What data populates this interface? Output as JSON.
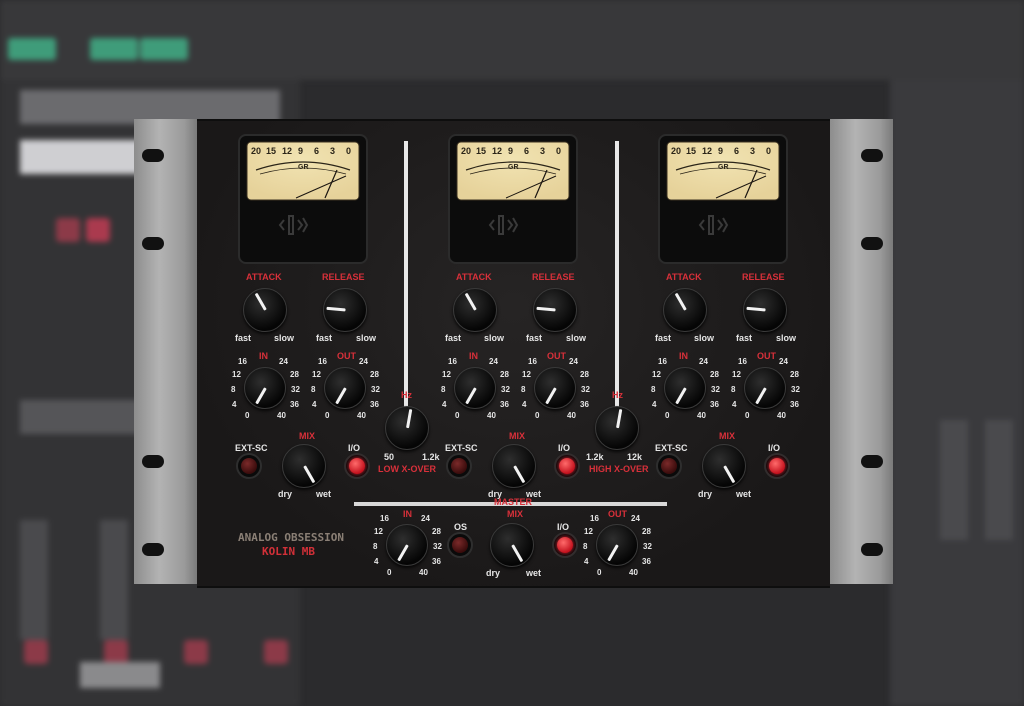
{
  "brand": {
    "line1": "ANALOG OBSESSION",
    "line2": "KOLIN MB"
  },
  "meter": {
    "scale": [
      "20",
      "15",
      "12",
      "9",
      "6",
      "3",
      "0"
    ],
    "gr": "GR"
  },
  "band": {
    "attack": "ATTACK",
    "release": "RELEASE",
    "fast": "fast",
    "slow": "slow",
    "in": "IN",
    "out": "OUT",
    "gain_ticks": {
      "t16": "16",
      "t24": "24",
      "t12": "12",
      "t28": "28",
      "t8": "8",
      "t32": "32",
      "t4": "4",
      "t36": "36",
      "t0": "0",
      "t40": "40"
    },
    "ext_sc": "EXT-SC",
    "mix": "MIX",
    "io": "I/O",
    "dry": "dry",
    "wet": "wet"
  },
  "low_xover": {
    "hz": "Hz",
    "min": "50",
    "max": "1.2k",
    "label": "LOW X-OVER"
  },
  "high_xover": {
    "hz": "Hz",
    "min": "1.2k",
    "max": "12k",
    "label": "HIGH X-OVER"
  },
  "master": {
    "label": "MASTER",
    "in": "IN",
    "os": "OS",
    "mix": "MIX",
    "io": "I/O",
    "out": "OUT",
    "dry": "dry",
    "wet": "wet"
  },
  "colors": {
    "accent_red": "#d8303a",
    "meter_face": "#e6d29a",
    "panel": "#1e1c1c"
  },
  "states": {
    "io_band1": "on",
    "io_band2": "on",
    "io_band3": "on",
    "io_master": "on",
    "ext_sc": "off",
    "os": "off"
  }
}
